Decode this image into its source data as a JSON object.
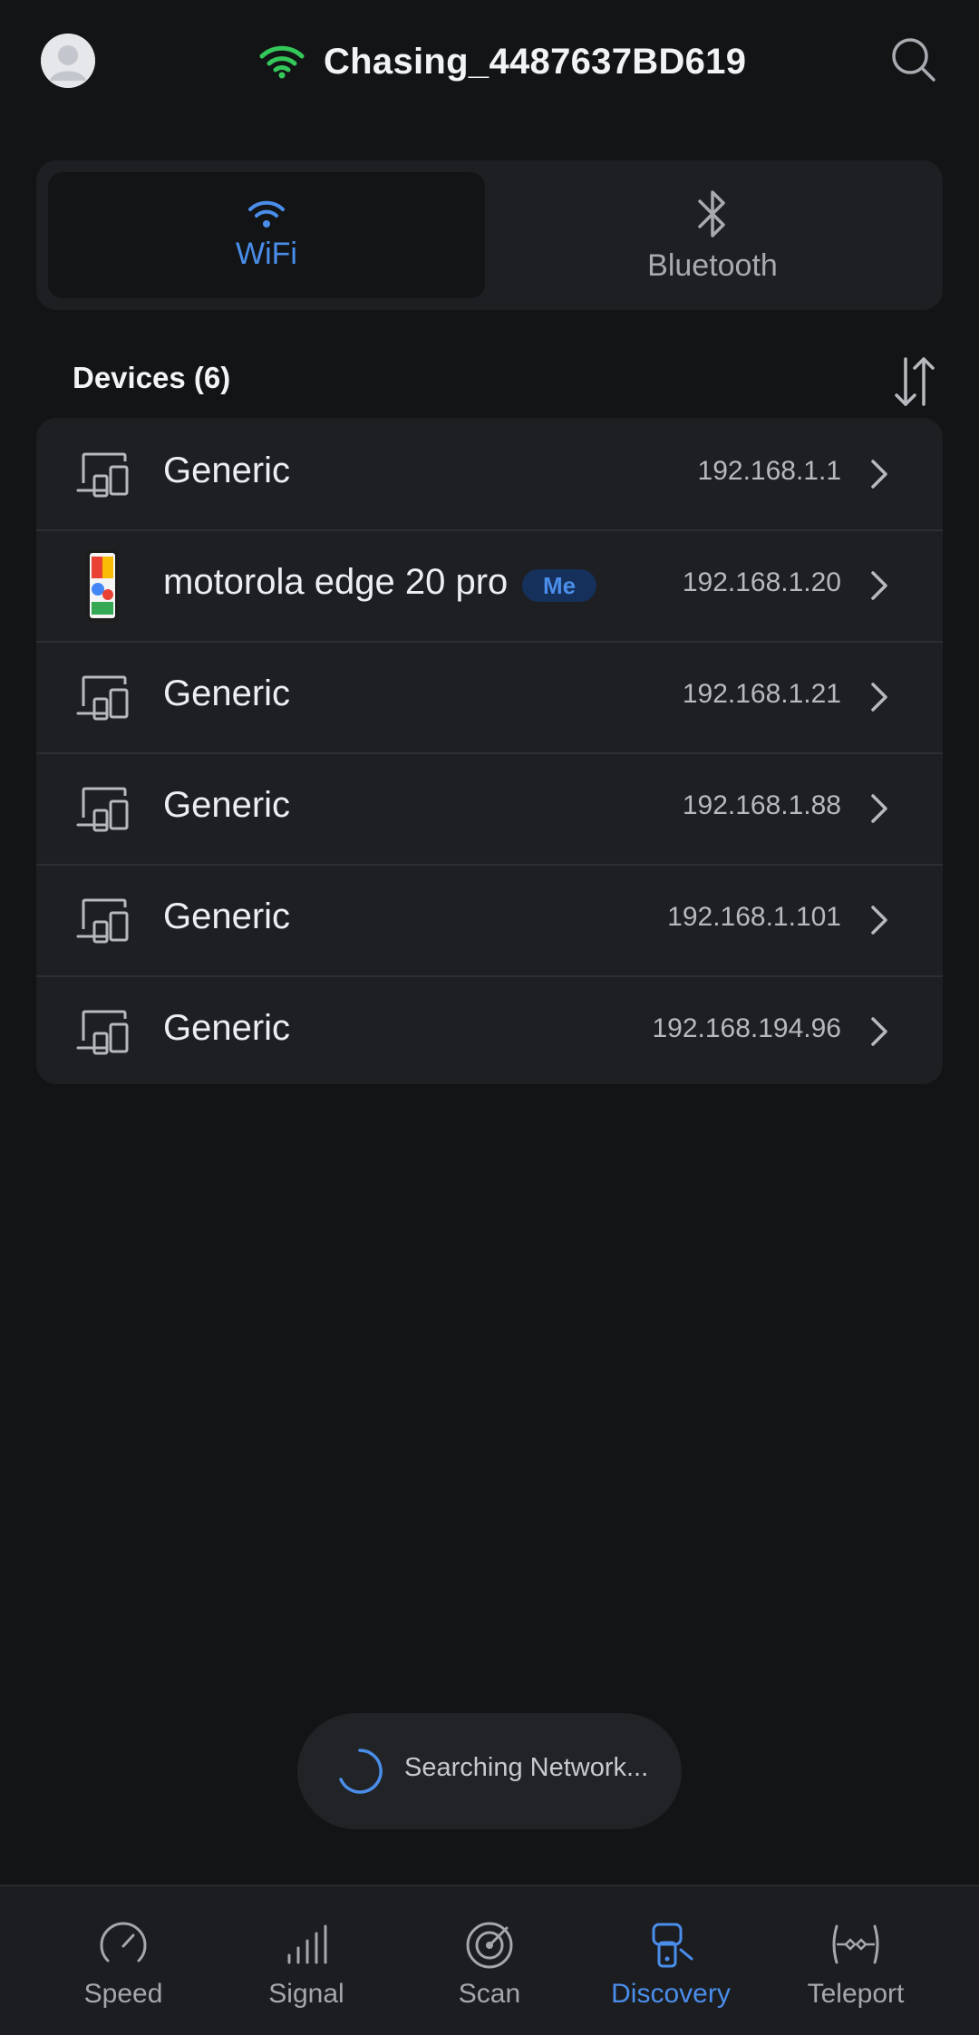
{
  "topbar": {
    "avatar_icon": "user-avatar-icon",
    "wifi_icon": "wifi-signal-icon",
    "network_name": "Chasing_4487637BD619",
    "search_icon": "search-icon"
  },
  "segment": {
    "tabs": [
      {
        "label": "WiFi",
        "icon": "wifi-icon",
        "selected": true
      },
      {
        "label": "Bluetooth",
        "icon": "bluetooth-icon",
        "selected": false
      }
    ]
  },
  "devices": {
    "header": "Devices (6)",
    "sort_icon": "sort-arrows-icon",
    "items": [
      {
        "name": "Generic",
        "ip": "192.168.1.1",
        "icon": "devices-icon",
        "badge": ""
      },
      {
        "name": "motorola edge 20 pro",
        "ip": "192.168.1.20",
        "icon": "phone-icon",
        "badge": "Me"
      },
      {
        "name": "Generic",
        "ip": "192.168.1.21",
        "icon": "devices-icon",
        "badge": ""
      },
      {
        "name": "Generic",
        "ip": "192.168.1.88",
        "icon": "devices-icon",
        "badge": ""
      },
      {
        "name": "Generic",
        "ip": "192.168.1.101",
        "icon": "devices-icon",
        "badge": ""
      },
      {
        "name": "Generic",
        "ip": "192.168.194.96",
        "icon": "devices-icon",
        "badge": ""
      }
    ]
  },
  "status": {
    "searching_text": "Searching Network..."
  },
  "bottom_nav": {
    "items": [
      {
        "label": "Speed",
        "icon": "speedometer-icon",
        "active": false
      },
      {
        "label": "Signal",
        "icon": "signal-bars-icon",
        "active": false
      },
      {
        "label": "Scan",
        "icon": "radar-icon",
        "active": false
      },
      {
        "label": "Discovery",
        "icon": "discovery-icon",
        "active": true
      },
      {
        "label": "Teleport",
        "icon": "teleport-icon",
        "active": false
      }
    ]
  },
  "colors": {
    "background": "#131416",
    "card": "#1e1f23",
    "accent": "#4a8eea",
    "wifi_green": "#34c759",
    "me_badge_bg": "#15305a"
  }
}
